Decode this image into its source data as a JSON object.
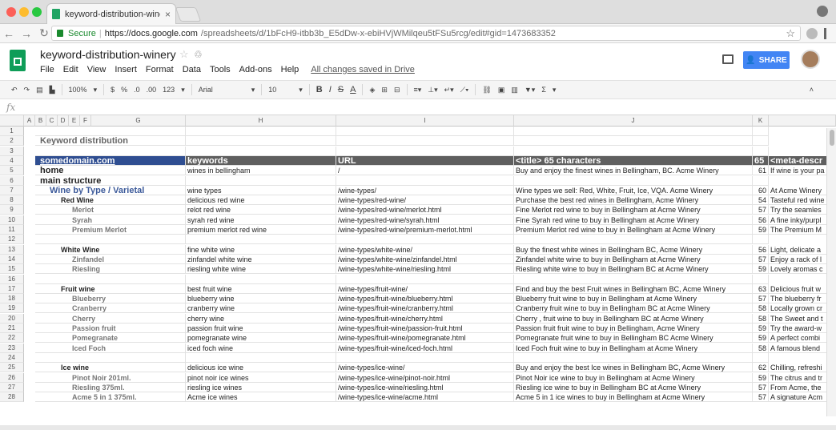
{
  "browser": {
    "tab_title": "keyword-distribution-winery -",
    "tab_close": "×",
    "secure_label": "Secure",
    "url_host": "https://docs.google.com",
    "url_path": "/spreadsheets/d/1bFcH9-itbb3b_E5dDw-x-ebiHVjWMilqeu5tFSu5rcg/edit#gid=1473683352"
  },
  "app": {
    "doc_title": "keyword-distribution-winery",
    "menus": [
      "File",
      "Edit",
      "View",
      "Insert",
      "Format",
      "Data",
      "Tools",
      "Add-ons",
      "Help"
    ],
    "saved_status": "All changes saved in Drive",
    "share_label": "SHARE"
  },
  "toolbar": {
    "zoom": "100%",
    "currency": "$",
    "percent": "%",
    "dec_minus": ".0",
    "dec_plus": ".00",
    "more_formats": "123",
    "font": "Arial",
    "font_size": "10",
    "bold": "B",
    "italic": "I",
    "strike": "S",
    "text_color": "A",
    "functions": "Σ"
  },
  "formula_bar": {
    "fx": "fx"
  },
  "columns": [
    "A",
    "B",
    "C",
    "D",
    "E",
    "F",
    "G",
    "H",
    "I",
    "J",
    "K"
  ],
  "rows": [
    {
      "n": "1",
      "cells": [
        "",
        "",
        "",
        "",
        ""
      ]
    },
    {
      "n": "2",
      "cells": [
        "Keyword distribution",
        "",
        "",
        "",
        ""
      ],
      "style": "title"
    },
    {
      "n": "3",
      "cells": [
        "",
        "",
        "",
        "",
        ""
      ]
    },
    {
      "n": "4",
      "cells": [
        "somedomain.com",
        "keywords",
        "URL",
        "<title> 65 characters",
        "65",
        "<meta-descr"
      ],
      "style": "hdr"
    },
    {
      "n": "5",
      "cells": [
        "home",
        "wines in bellingham",
        "/",
        "Buy and enjoy the finest wines in Bellingham, BC. Acme Winery",
        "61",
        "If wine is your pa"
      ],
      "style": "big",
      "indent": 0
    },
    {
      "n": "6",
      "cells": [
        "main structure",
        "",
        "",
        "",
        ""
      ],
      "style": "big",
      "indent": 0
    },
    {
      "n": "7",
      "cells": [
        "Wine by Type / Varietal",
        "wine types",
        "/wine-types/",
        "Wine types we sell: Red, White, Fruit, Ice, VQA. Acme Winery",
        "60",
        "At Acme Winery"
      ],
      "style": "cat",
      "indent": 1
    },
    {
      "n": "8",
      "cells": [
        "Red Wine",
        "delicious red wine",
        "/wine-types/red-wine/",
        "Purchase the best red wines in Bellingham, Acme Winery",
        "54",
        "Tasteful red wine"
      ],
      "style": "bold",
      "indent": 2
    },
    {
      "n": "9",
      "cells": [
        "Merlot",
        "relot red wine",
        "/wine-types/red-wine/merlot.html",
        "Fine Merlot  red wine to buy in Bellingham at Acme Winery",
        "57",
        "Try the seamles"
      ],
      "style": "sub",
      "indent": 3
    },
    {
      "n": "10",
      "cells": [
        "Syrah",
        "syrah red wine",
        "/wine-types/red-wine/syrah.html",
        "Fine Syrah  red wine to buy in Bellingham at Acme Winery",
        "56",
        "A fine inky/purpl"
      ],
      "style": "sub",
      "indent": 3
    },
    {
      "n": "11",
      "cells": [
        "Premium Merlot",
        "premium merlot red wine",
        "/wine-types/red-wine/premium-merlot.html",
        "Premium Merlot red wine to buy in Bellingham at Acme Winery",
        "59",
        "The Premium M"
      ],
      "style": "sub",
      "indent": 3
    },
    {
      "n": "12",
      "cells": [
        "",
        "",
        "",
        "",
        ""
      ]
    },
    {
      "n": "13",
      "cells": [
        "White Wine",
        "fine white wine",
        "/wine-types/white-wine/",
        "Buy the finest white wines in Bellingham BC, Acme Winery",
        "56",
        "Light, delicate a"
      ],
      "style": "bold",
      "indent": 2
    },
    {
      "n": "14",
      "cells": [
        "Zinfandel",
        "zinfandel white wine",
        "/wine-types/white-wine/zinfandel.html",
        "Zinfandel  white wine to buy in Bellingham at Acme Winery",
        "57",
        "Enjoy a rack of l"
      ],
      "style": "sub",
      "indent": 3
    },
    {
      "n": "15",
      "cells": [
        "Riesling",
        "riesling white wine",
        "/wine-types/white-wine/riesling.html",
        "Riesling white wine  to buy in Bellingham BC at Acme Winery",
        "59",
        "Lovely aromas c"
      ],
      "style": "sub",
      "indent": 3
    },
    {
      "n": "16",
      "cells": [
        "",
        "",
        "",
        "",
        ""
      ]
    },
    {
      "n": "17",
      "cells": [
        "Fruit wine",
        "best fruit wine",
        "/wine-types/fruit-wine/",
        "Find and buy the best Fruit wines in Bellingham BC, Acme Winery",
        "63",
        "Delicious fruit w"
      ],
      "style": "bold",
      "indent": 2
    },
    {
      "n": "18",
      "cells": [
        "Blueberry",
        "blueberry wine",
        "/wine-types/fruit-wine/blueberry.html",
        "Blueberry fruit wine  to buy in Bellingham at Acme Winery",
        "57",
        "The blueberry fr"
      ],
      "style": "sub",
      "indent": 3
    },
    {
      "n": "19",
      "cells": [
        "Cranberry",
        "cranberry wine",
        "/wine-types/fruit-wine/cranberry.html",
        "Cranberry  fruit wine to buy in Bellingham BC at Acme Winery",
        "58",
        "Locally grown cr"
      ],
      "style": "sub",
      "indent": 3
    },
    {
      "n": "20",
      "cells": [
        "Cherry",
        "cherry wine",
        "/wine-types/fruit-wine/cherry.html",
        "Cherry , fruit wine to buy in Bellingham BC at Acme Winery",
        "58",
        "The Sweet and t"
      ],
      "style": "sub",
      "indent": 3
    },
    {
      "n": "21",
      "cells": [
        "Passion fruit",
        "passion fruit wine",
        "/wine-types/fruit-wine/passion-fruit.html",
        "Passion fruit  fruit wine to buy in Bellingham, Acme Winery",
        "59",
        "Try the award-w"
      ],
      "style": "sub",
      "indent": 3
    },
    {
      "n": "22",
      "cells": [
        "Pomegranate",
        "pomegranate wine",
        "/wine-types/fruit-wine/pomegranate.html",
        "Pomegranate fruit wine to buy in Bellingham BC Acme Winery",
        "59",
        "A perfect combi"
      ],
      "style": "sub",
      "indent": 3
    },
    {
      "n": "23",
      "cells": [
        "Iced Foch",
        "iced foch wine",
        "/wine-types/fruit-wine/iced-foch.html",
        "Iced Foch  fruit wine to buy in Bellingham at Acme Winery",
        "58",
        "A famous blend"
      ],
      "style": "sub",
      "indent": 3
    },
    {
      "n": "24",
      "cells": [
        "",
        "",
        "",
        "",
        ""
      ]
    },
    {
      "n": "25",
      "cells": [
        "Ice wine",
        "delicious ice wine",
        "/wine-types/ice-wine/",
        "Buy and enjoy the best Ice wines in Bellingham BC, Acme Winery",
        "62",
        "Chilling, refreshi"
      ],
      "style": "bold",
      "indent": 2
    },
    {
      "n": "26",
      "cells": [
        "Pinot Noir  201ml.",
        "pinot noir ice wines",
        "/wine-types/ice-wine/pinot-noir.html",
        "Pinot Noir  ice wine  to buy in Bellingham at Acme Winery",
        "59",
        "The citrus and tr"
      ],
      "style": "sub",
      "indent": 3
    },
    {
      "n": "27",
      "cells": [
        "Riesling  375ml.",
        "riesling ice wines",
        "/wine-types/ice-wine/riesling.html",
        "Riesling ice wine  to buy in Bellingham BC at Acme Winery",
        "57",
        "From Acme, the"
      ],
      "style": "sub",
      "indent": 3
    },
    {
      "n": "28",
      "cells": [
        "Acme 5 in 1 375ml.",
        "Acme ice wines",
        "/wine-types/ice-wine/acme.html",
        "Acme 5 in 1 ice wines to buy in Bellingham at Acme Winery",
        "57",
        "A signature Acm"
      ],
      "style": "sub",
      "indent": 3
    }
  ]
}
